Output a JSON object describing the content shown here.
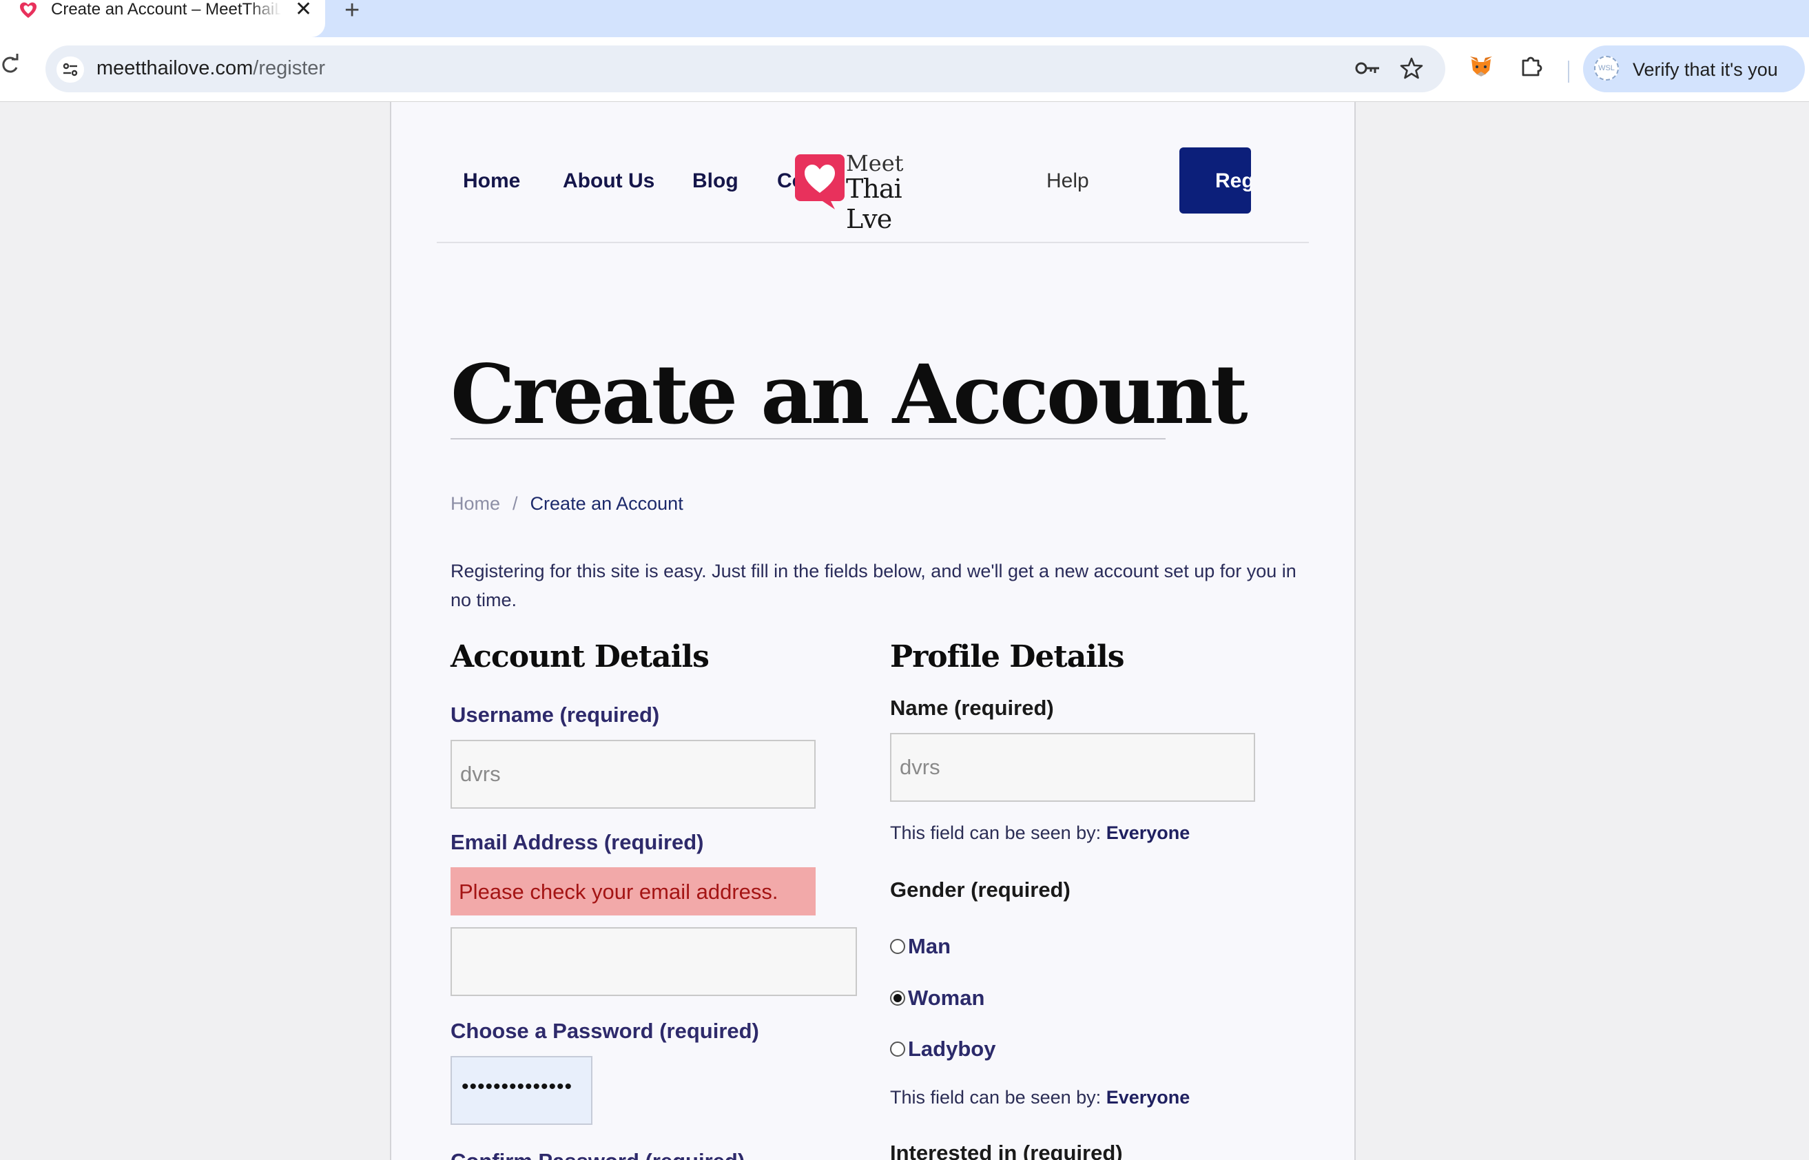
{
  "browser": {
    "tab_title": "Create an Account – MeetThaiLove",
    "tab_close": "✕",
    "new_tab": "+",
    "url_host": "meetthailove.com",
    "url_path": "/register",
    "verify_label": "Verify that it's you",
    "verify_avatar_text": "WSL"
  },
  "nav": {
    "items": [
      "Home",
      "About Us",
      "Blog",
      "Co",
      "Help"
    ],
    "logo_line1": "Meet",
    "logo_line2": "Thai Lve",
    "register_label": "Reg"
  },
  "page": {
    "title": "Create an Account",
    "breadcrumb": {
      "home": "Home",
      "separator": "/",
      "current": "Create an Account"
    },
    "intro": "Registering for this site is easy. Just fill in the fields below, and we'll get a new account set up for you in no time."
  },
  "account": {
    "heading": "Account Details",
    "username_label": "Username (required)",
    "username_value": "dvrs",
    "email_label": "Email Address (required)",
    "email_error": "Please check your email address.",
    "email_value": "",
    "password_label": "Choose a Password (required)",
    "password_value": "••••••••••••••",
    "confirm_label_partial": "Confirm Password (required)"
  },
  "profile": {
    "heading": "Profile Details",
    "name_label": "Name (required)",
    "name_value": "dvrs",
    "visibility_prefix": "This field can be seen by:",
    "visibility_value": "Everyone",
    "gender_label": "Gender (required)",
    "gender_options": [
      "Man",
      "Woman",
      "Ladyboy"
    ],
    "gender_selected": "Woman",
    "interested_label": "Interested in (required)"
  },
  "colors": {
    "brand_navy": "#0c1f7a",
    "brand_pink": "#e8315c",
    "error_bg": "#f2a9a9",
    "label_purple": "#2e2a6b"
  }
}
